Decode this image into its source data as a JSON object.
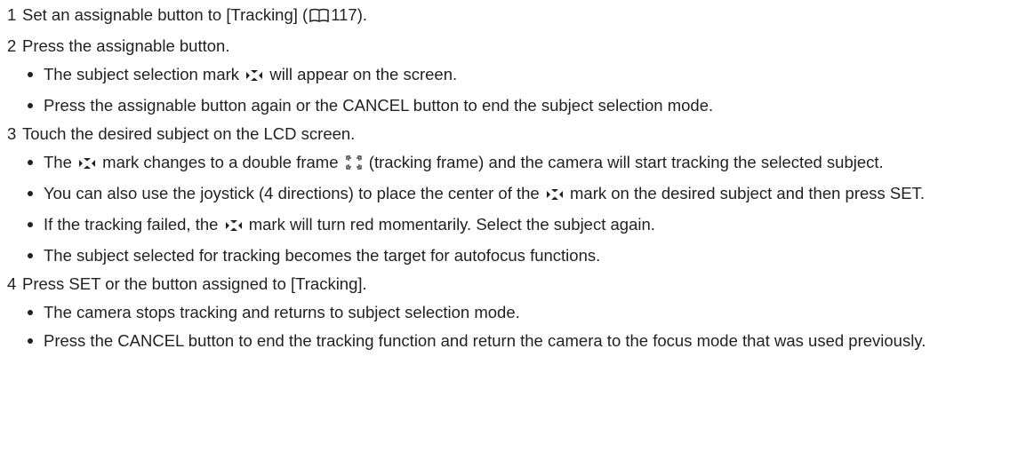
{
  "steps": [
    {
      "number": "1",
      "text_a": "Set an assignable button to [Tracking] (",
      "page_ref_icon": "book-icon",
      "page_ref": "117",
      "text_b": ")."
    },
    {
      "number": "2",
      "text": "Press the assignable button.",
      "bullets": [
        {
          "text_a": "The subject selection mark ",
          "icon": "subject-selection-mark-icon",
          "text_b": " will appear on the screen."
        },
        {
          "text": "Press the assignable button again or the CANCEL button to end the subject selection mode."
        }
      ]
    },
    {
      "number": "3",
      "text": "Touch the desired subject on the LCD screen.",
      "bullets": [
        {
          "text_a": "The ",
          "icon": "subject-selection-mark-icon",
          "text_b": " mark changes to a double frame ",
          "icon2": "tracking-frame-icon",
          "text_c": " (tracking frame) and the camera will start tracking the selected subject."
        },
        {
          "text_a": "You can also use the joystick (4 directions) to place the center of the ",
          "icon": "subject-selection-mark-icon",
          "text_b": " mark on the desired subject and then press SET."
        },
        {
          "text_a": "If the tracking failed, the ",
          "icon": "subject-selection-mark-icon",
          "text_b": " mark will turn red momentarily. Select the subject again."
        },
        {
          "text": "The subject selected for tracking becomes the target for autofocus functions."
        }
      ]
    },
    {
      "number": "4",
      "text": "Press SET or the button assigned to [Tracking].",
      "bullets": [
        {
          "text": "The camera stops tracking and returns to subject selection mode."
        },
        {
          "text": "Press the CANCEL button to end the tracking function and return the camera to the focus mode that was used previously."
        }
      ]
    }
  ]
}
